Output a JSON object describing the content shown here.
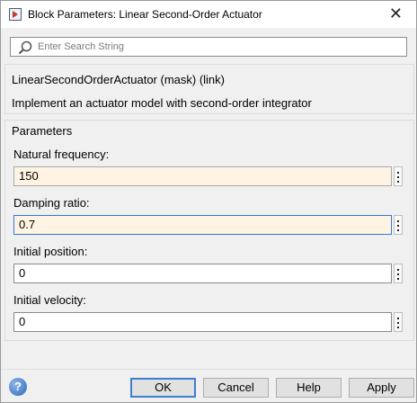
{
  "window": {
    "title": "Block Parameters: Linear Second-Order Actuator",
    "close_glyph": "✕"
  },
  "search": {
    "placeholder": "Enter Search String",
    "value": ""
  },
  "description": {
    "title": "LinearSecondOrderActuator (mask) (link)",
    "text": "Implement an actuator model with second-order integrator"
  },
  "parameters": {
    "title": "Parameters",
    "fields": [
      {
        "label": "Natural frequency:",
        "value": "150",
        "state": "modified"
      },
      {
        "label": "Damping ratio:",
        "value": "0.7",
        "state": "modified-focused"
      },
      {
        "label": "Initial position:",
        "value": "0",
        "state": "normal"
      },
      {
        "label": "Initial velocity:",
        "value": "0",
        "state": "normal"
      }
    ]
  },
  "footer": {
    "help_icon_glyph": "?",
    "ok_label": "OK",
    "cancel_label": "Cancel",
    "help_label": "Help",
    "apply_label": "Apply"
  },
  "icons": {
    "app": "block-parameters-icon",
    "search": "magnifier-icon",
    "kebab": "vertical-ellipsis-icon",
    "help": "help-question-icon"
  },
  "colors": {
    "modified_field_bg": "#fff4e3",
    "focus_border": "#2a7bd4",
    "dialog_bg": "#f0f0f0"
  }
}
